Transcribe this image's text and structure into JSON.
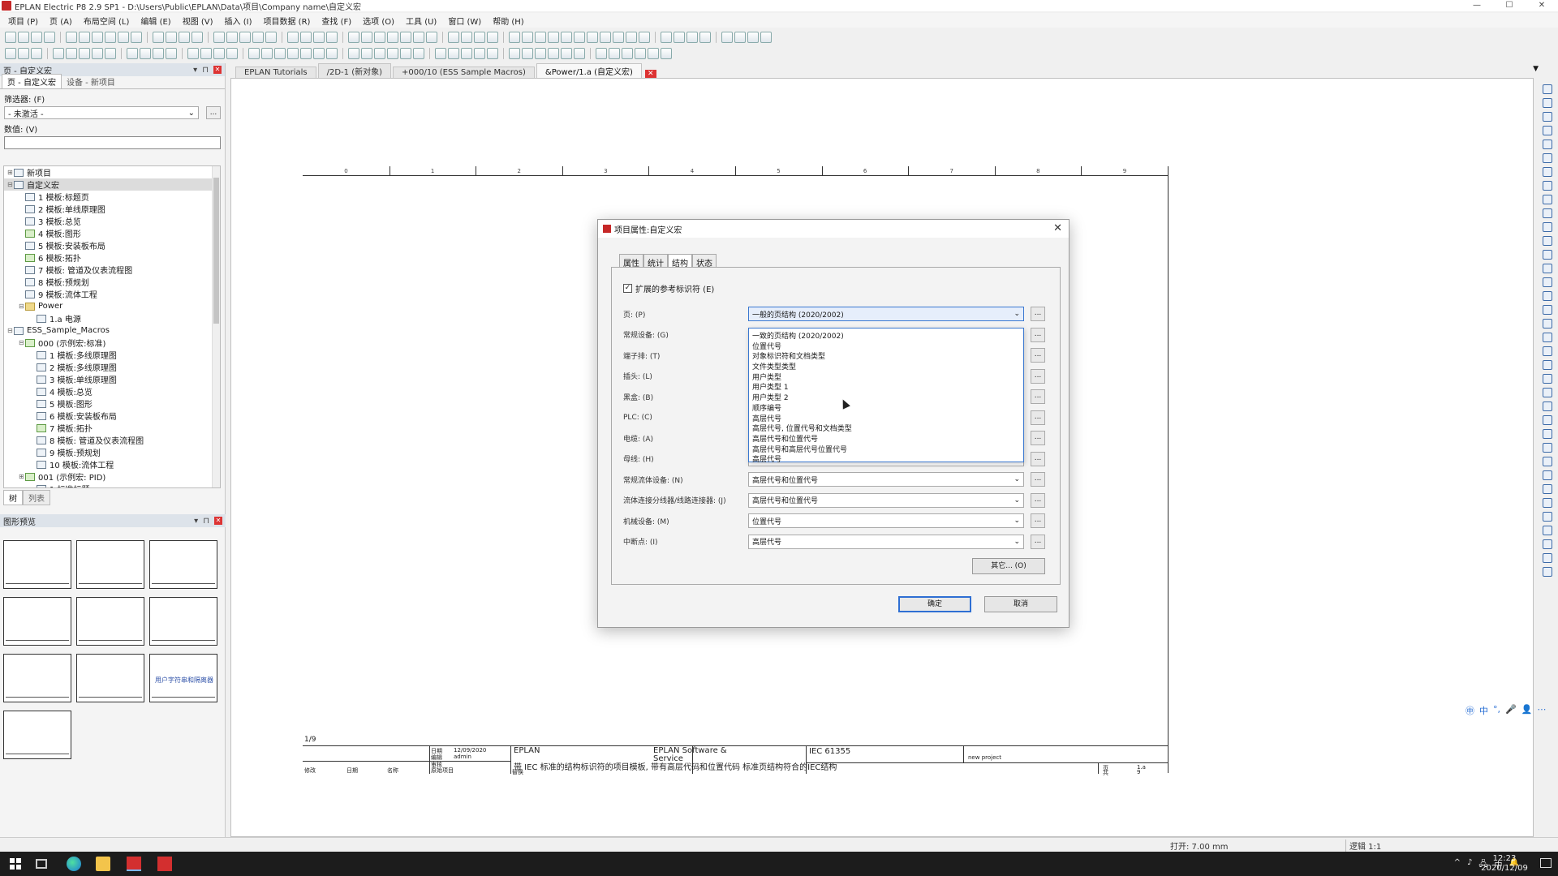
{
  "window": {
    "title": "EPLAN Electric P8 2.9 SP1 - D:\\Users\\Public\\EPLAN\\Data\\项目\\Company name\\自定义宏",
    "minimize": "—",
    "maximize": "☐",
    "close": "✕"
  },
  "menu": [
    "项目 (P)",
    "页 (A)",
    "布局空间 (L)",
    "编辑 (E)",
    "视图 (V)",
    "插入 (I)",
    "项目数据 (R)",
    "查找 (F)",
    "选项 (O)",
    "工具 (U)",
    "窗口 (W)",
    "帮助 (H)"
  ],
  "left_panel": {
    "title": "页 - 自定义宏",
    "tabs": [
      "页 - 自定义宏",
      "设备 - 新项目"
    ],
    "filter_label": "筛选器: (F)",
    "filter_value": "- 未激活 -",
    "filter_btn": "...",
    "value_label": "数值: (V)",
    "tree": [
      {
        "indent": 0,
        "twist": "⊞",
        "icon": "page",
        "label": "新项目"
      },
      {
        "indent": 0,
        "twist": "⊟",
        "icon": "page",
        "label": "自定义宏",
        "selected": true
      },
      {
        "indent": 1,
        "twist": "",
        "icon": "page",
        "label": "1 模板:标题页"
      },
      {
        "indent": 1,
        "twist": "",
        "icon": "page",
        "label": "2 模板:单线原理图"
      },
      {
        "indent": 1,
        "twist": "",
        "icon": "page",
        "label": "3 模板:总览"
      },
      {
        "indent": 1,
        "twist": "",
        "icon": "green",
        "label": "4 模板:图形"
      },
      {
        "indent": 1,
        "twist": "",
        "icon": "page",
        "label": "5 模板:安装板布局"
      },
      {
        "indent": 1,
        "twist": "",
        "icon": "green",
        "label": "6 模板:拓扑"
      },
      {
        "indent": 1,
        "twist": "",
        "icon": "page",
        "label": "7 模板: 管道及仪表流程图"
      },
      {
        "indent": 1,
        "twist": "",
        "icon": "page",
        "label": "8 模板:预规划"
      },
      {
        "indent": 1,
        "twist": "",
        "icon": "page",
        "label": "9 模板:流体工程"
      },
      {
        "indent": 1,
        "twist": "⊟",
        "icon": "folder",
        "label": "Power"
      },
      {
        "indent": 2,
        "twist": "",
        "icon": "page",
        "label": "1.a 电源"
      },
      {
        "indent": 0,
        "twist": "⊟",
        "icon": "page",
        "label": "ESS_Sample_Macros"
      },
      {
        "indent": 1,
        "twist": "⊟",
        "icon": "green",
        "label": "000 (示例宏:标准)"
      },
      {
        "indent": 2,
        "twist": "",
        "icon": "page",
        "label": "1 模板:多线原理图"
      },
      {
        "indent": 2,
        "twist": "",
        "icon": "page",
        "label": "2 模板:多线原理图"
      },
      {
        "indent": 2,
        "twist": "",
        "icon": "page",
        "label": "3 模板:单线原理图"
      },
      {
        "indent": 2,
        "twist": "",
        "icon": "page",
        "label": "4 模板:总览"
      },
      {
        "indent": 2,
        "twist": "",
        "icon": "page",
        "label": "5 模板:图形"
      },
      {
        "indent": 2,
        "twist": "",
        "icon": "page",
        "label": "6 模板:安装板布局"
      },
      {
        "indent": 2,
        "twist": "",
        "icon": "green",
        "label": "7 模板:拓扑"
      },
      {
        "indent": 2,
        "twist": "",
        "icon": "page",
        "label": "8 模板: 管道及仪表流程图"
      },
      {
        "indent": 2,
        "twist": "",
        "icon": "page",
        "label": "9 模板:预规划"
      },
      {
        "indent": 2,
        "twist": "",
        "icon": "page",
        "label": "10 模板:流体工程"
      },
      {
        "indent": 1,
        "twist": "⊞",
        "icon": "green",
        "label": "001 (示例宏: PID)"
      },
      {
        "indent": 2,
        "twist": "",
        "icon": "page",
        "label": "1 标准标题"
      }
    ],
    "bottom_tabs": [
      "树",
      "列表"
    ],
    "preview_title": "图形预览",
    "thumb_label": "用户字符串和隔离器"
  },
  "doc_tabs": [
    {
      "label": "EPLAN Tutorials",
      "active": false
    },
    {
      "label": "/2D-1 (新对象)",
      "active": false
    },
    {
      "label": "+000/10 (ESS Sample Macros)",
      "active": false
    },
    {
      "label": "&Power/1.a (自定义宏)",
      "active": true
    }
  ],
  "doc_tab_close": "✕",
  "doc_tabs_menu": "▼",
  "sheet": {
    "columns": [
      "0",
      "1",
      "2",
      "3",
      "4",
      "5",
      "6",
      "7",
      "8",
      "9"
    ],
    "page_id": "1/9",
    "title_block": {
      "date_label": "日期",
      "date_value": "12/09/2020",
      "editor_label": "编辑",
      "editor_value": "admin",
      "check_label": "审核",
      "row_mod": "修改",
      "row_date": "日期",
      "row_name": "名称",
      "row_orig": "原始项目",
      "company": "EPLAN",
      "vendor": "EPLAN Software &",
      "service": "Service",
      "desc": "带 IEC 标准的结构标识符的项目模板, 带有高层代码和位置代码 标准页结构符合的IEC结构",
      "replace": "替换",
      "page_code": "IEC 61355",
      "project_no": "new project",
      "page_label": "页",
      "page_num": "1.a",
      "total_label": "共",
      "total_num": "9"
    }
  },
  "dialog": {
    "title": "项目属性:自定义宏",
    "close": "✕",
    "tabs": [
      "属性",
      "统计",
      "结构",
      "状态"
    ],
    "active_tab": 2,
    "check_label": "扩展的参考标识符 (E)",
    "check_mark": "✓",
    "rows": [
      {
        "label": "页: (P)",
        "value": "一般的页结构 (2020/2002)",
        "active": true
      },
      {
        "label": "常规设备: (G)",
        "value": ""
      },
      {
        "label": "端子排: (T)",
        "value": ""
      },
      {
        "label": "插头: (L)",
        "value": ""
      },
      {
        "label": "黑盒: (B)",
        "value": ""
      },
      {
        "label": "PLC: (C)",
        "value": ""
      },
      {
        "label": "电缆: (A)",
        "value": ""
      },
      {
        "label": "母线: (H)",
        "value": "位置代号"
      },
      {
        "label": "常规流体设备: (N)",
        "value": "高层代号和位置代号"
      },
      {
        "label": "流体连接分线器/线路连接器: (J)",
        "value": "高层代号和位置代号"
      },
      {
        "label": "机械设备: (M)",
        "value": "位置代号"
      },
      {
        "label": "中断点: (I)",
        "value": "高层代号"
      }
    ],
    "ellipsis": "...",
    "dropdown_options": [
      "一致的页结构 (2020/2002)",
      "位置代号",
      "对象标识符和文档类型",
      "文件类型类型",
      "用户类型",
      "用户类型 1",
      "用户类型 2",
      "顺序编号",
      "高层代号",
      "高层代号, 位置代号和文档类型",
      "高层代号和位置代号",
      "高层代号和高层代号位置代号",
      "高层代号"
    ],
    "others": "其它... (O)",
    "ok": "确定",
    "cancel": "取消"
  },
  "ime": [
    "㊥",
    "中",
    "°,",
    "🎤",
    "👤",
    "⋯"
  ],
  "status": {
    "open": "打开: 7.00 mm",
    "logic": "逻辑 1:1"
  },
  "taskbar": {
    "tray": [
      "^",
      "♪",
      "🖧",
      "中",
      "🔔"
    ],
    "time": "12:23",
    "date": "2020/12/09"
  }
}
